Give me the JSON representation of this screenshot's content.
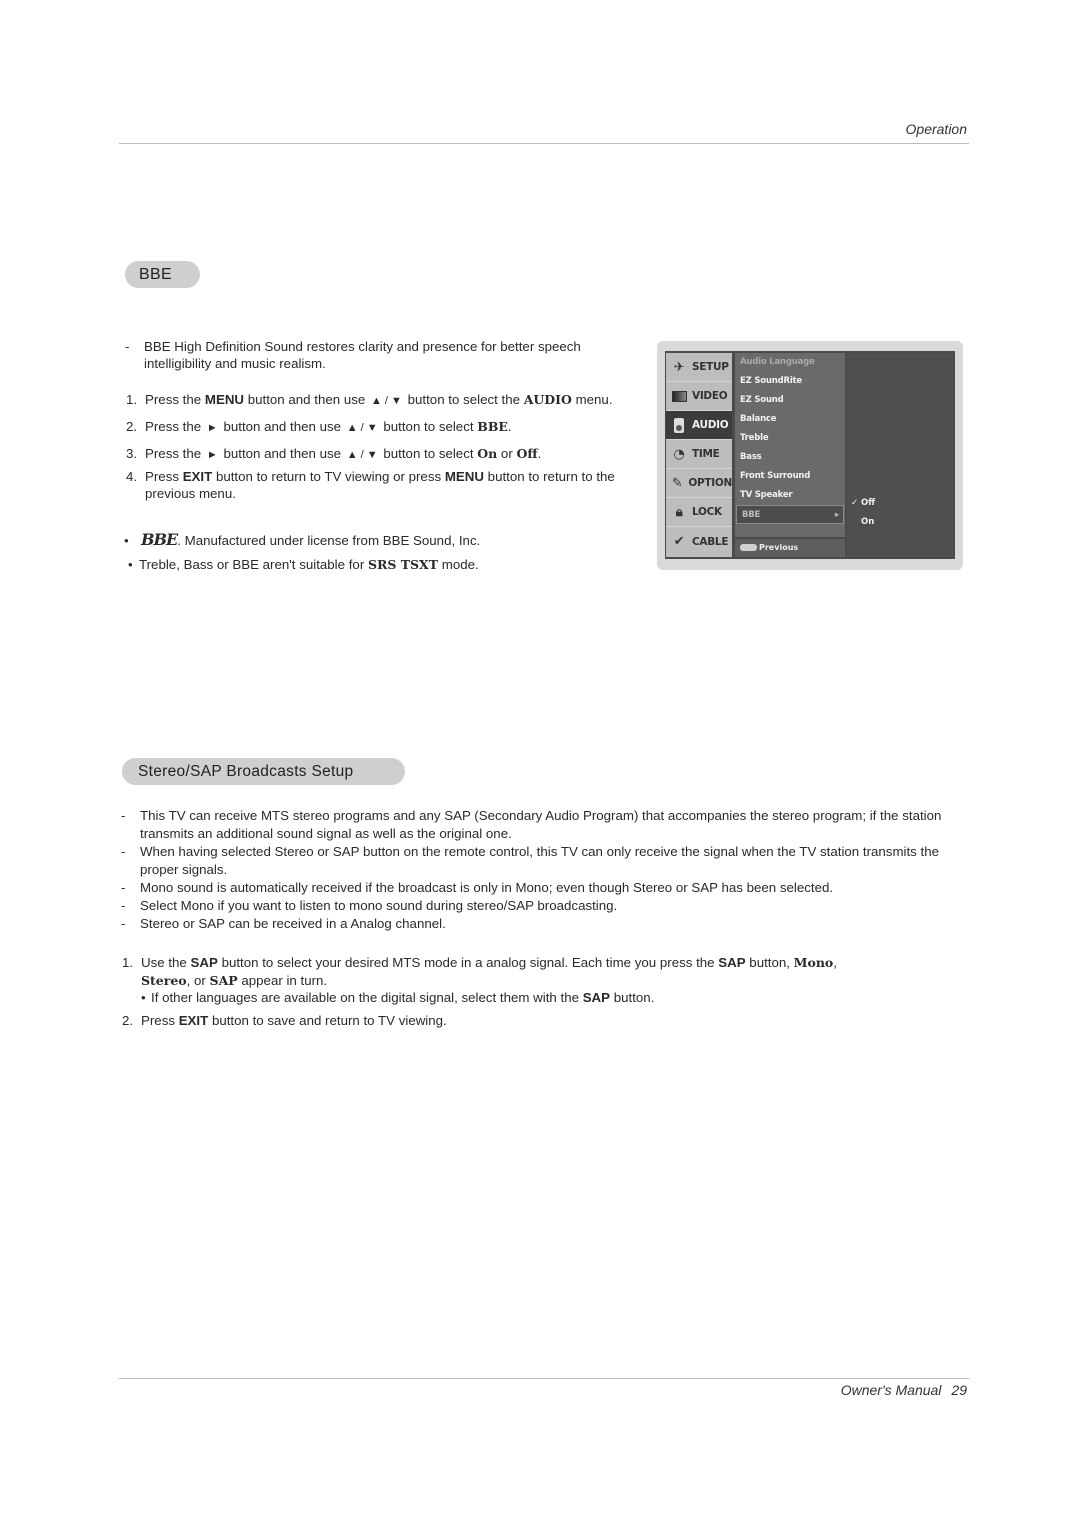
{
  "header": {
    "section": "Operation"
  },
  "footer": {
    "label": "Owner's Manual",
    "page": "29"
  },
  "bbe": {
    "title": "BBE",
    "intro": "BBE High Definition Sound restores clarity and presence for better speech intelligibility and music realism.",
    "steps": [
      {
        "n": "1.",
        "parts": [
          "Press the ",
          "MENU",
          " button and then use ",
          "▲ / ▼",
          " button to select the ",
          "AUDIO",
          " menu."
        ]
      },
      {
        "n": "2.",
        "parts": [
          "Press the ",
          "►",
          " button and then use ",
          "▲ / ▼",
          " button to select ",
          "BBE",
          "."
        ]
      },
      {
        "n": "3.",
        "parts": [
          "Press the ",
          "►",
          " button and then use ",
          "▲ / ▼",
          " button to select ",
          "On",
          " or ",
          "Off",
          "."
        ]
      },
      {
        "n": "4.",
        "parts": [
          "Press ",
          "EXIT",
          " button to return to TV viewing or press ",
          "MENU",
          " button to return to the previous menu."
        ]
      }
    ],
    "notes": {
      "logo": "BBE",
      "license": "Manufactured under license from BBE Sound, Inc.",
      "suitability_pre": "Treble, Bass or BBE aren't suitable for ",
      "suitability_mode": "SRS TSXT",
      "suitability_post": " mode."
    }
  },
  "osd": {
    "tabs": [
      {
        "label": "SETUP",
        "icon": "satellite-icon"
      },
      {
        "label": "VIDEO",
        "icon": "screen-icon"
      },
      {
        "label": "AUDIO",
        "icon": "speaker-icon",
        "active": true
      },
      {
        "label": "TIME",
        "icon": "clock-icon"
      },
      {
        "label": "OPTION",
        "icon": "wrench-icon"
      },
      {
        "label": "LOCK",
        "icon": "padlock-icon"
      },
      {
        "label": "CABLE",
        "icon": "cable-icon"
      }
    ],
    "items": [
      "Audio Language",
      "EZ SoundRite",
      "EZ Sound",
      "Balance",
      "Treble",
      "Bass",
      "Front Surround",
      "TV Speaker",
      "BBE"
    ],
    "selected_item": "BBE",
    "previous_label": "Previous",
    "options": [
      {
        "label": "Off",
        "checked": true
      },
      {
        "label": "On",
        "checked": false
      }
    ]
  },
  "sap": {
    "title": "Stereo/SAP Broadcasts Setup",
    "bullets": [
      "This TV can receive MTS stereo programs and any SAP (Secondary Audio Program) that accompanies the stereo program; if the station transmits an additional sound signal as well as the original one.",
      "When having selected Stereo or SAP button on the remote control, this TV can only receive the signal when the TV station transmits the proper signals.",
      "Mono sound is automatically received if the broadcast is only in Mono; even though Stereo or SAP has been selected.",
      "Select Mono if you want to listen to mono sound during stereo/SAP broadcasting.",
      "Stereo or SAP can be received in a Analog channel."
    ],
    "step1": {
      "n": "1.",
      "a": "Use the ",
      "b": "SAP",
      "c": " button to select your desired MTS mode in a analog signal. Each time you press the ",
      "d": "SAP",
      "e": " button, ",
      "f": "Mono",
      "g": ",",
      "h": "Stereo",
      "i": ", or ",
      "j": "SAP",
      "k": " appear in turn."
    },
    "step1_note": {
      "a": "If other languages are available on the digital signal, select them with the ",
      "b": "SAP",
      "c": " button."
    },
    "step2": {
      "n": "2.",
      "a": "Press ",
      "b": "EXIT",
      "c": " button to save and return to TV viewing."
    }
  }
}
